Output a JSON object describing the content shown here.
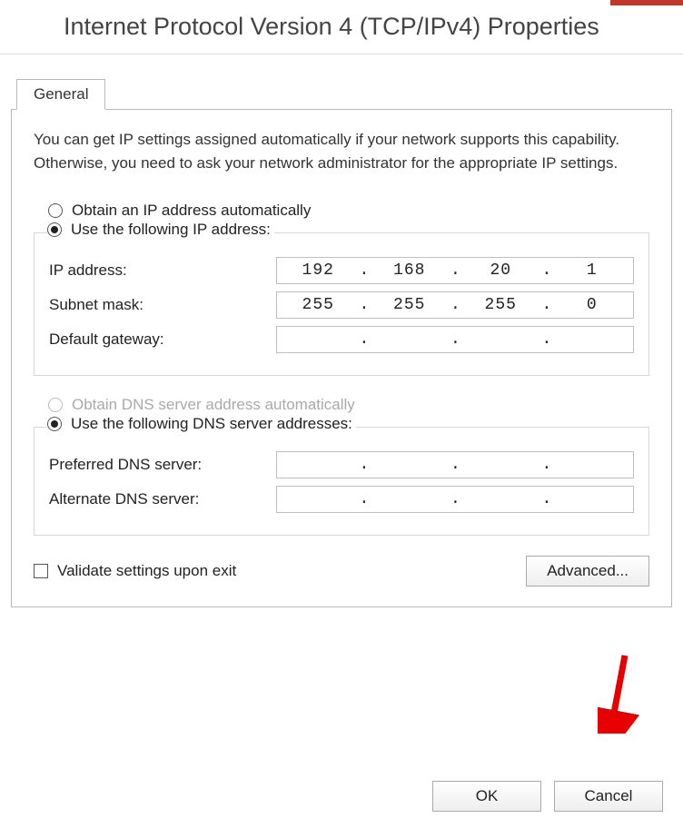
{
  "window": {
    "title": "Internet Protocol Version 4 (TCP/IPv4) Properties"
  },
  "tabs": {
    "general": "General"
  },
  "description": "You can get IP settings assigned automatically if your network supports this capability. Otherwise, you need to ask your network administrator for the appropriate IP settings.",
  "ip": {
    "radio_auto": "Obtain an IP address automatically",
    "radio_manual": "Use the following IP address:",
    "labels": {
      "ip": "IP address:",
      "mask": "Subnet mask:",
      "gateway": "Default gateway:"
    },
    "values": {
      "ip": [
        "192",
        "168",
        "20",
        "1"
      ],
      "mask": [
        "255",
        "255",
        "255",
        "0"
      ],
      "gateway": [
        "",
        "",
        "",
        ""
      ]
    }
  },
  "dns": {
    "radio_auto": "Obtain DNS server address automatically",
    "radio_manual": "Use the following DNS server addresses:",
    "labels": {
      "pref": "Preferred DNS server:",
      "alt": "Alternate DNS server:"
    },
    "values": {
      "pref": [
        "",
        "",
        "",
        ""
      ],
      "alt": [
        "",
        "",
        "",
        ""
      ]
    }
  },
  "validate": "Validate settings upon exit",
  "buttons": {
    "advanced": "Advanced...",
    "ok": "OK",
    "cancel": "Cancel"
  }
}
